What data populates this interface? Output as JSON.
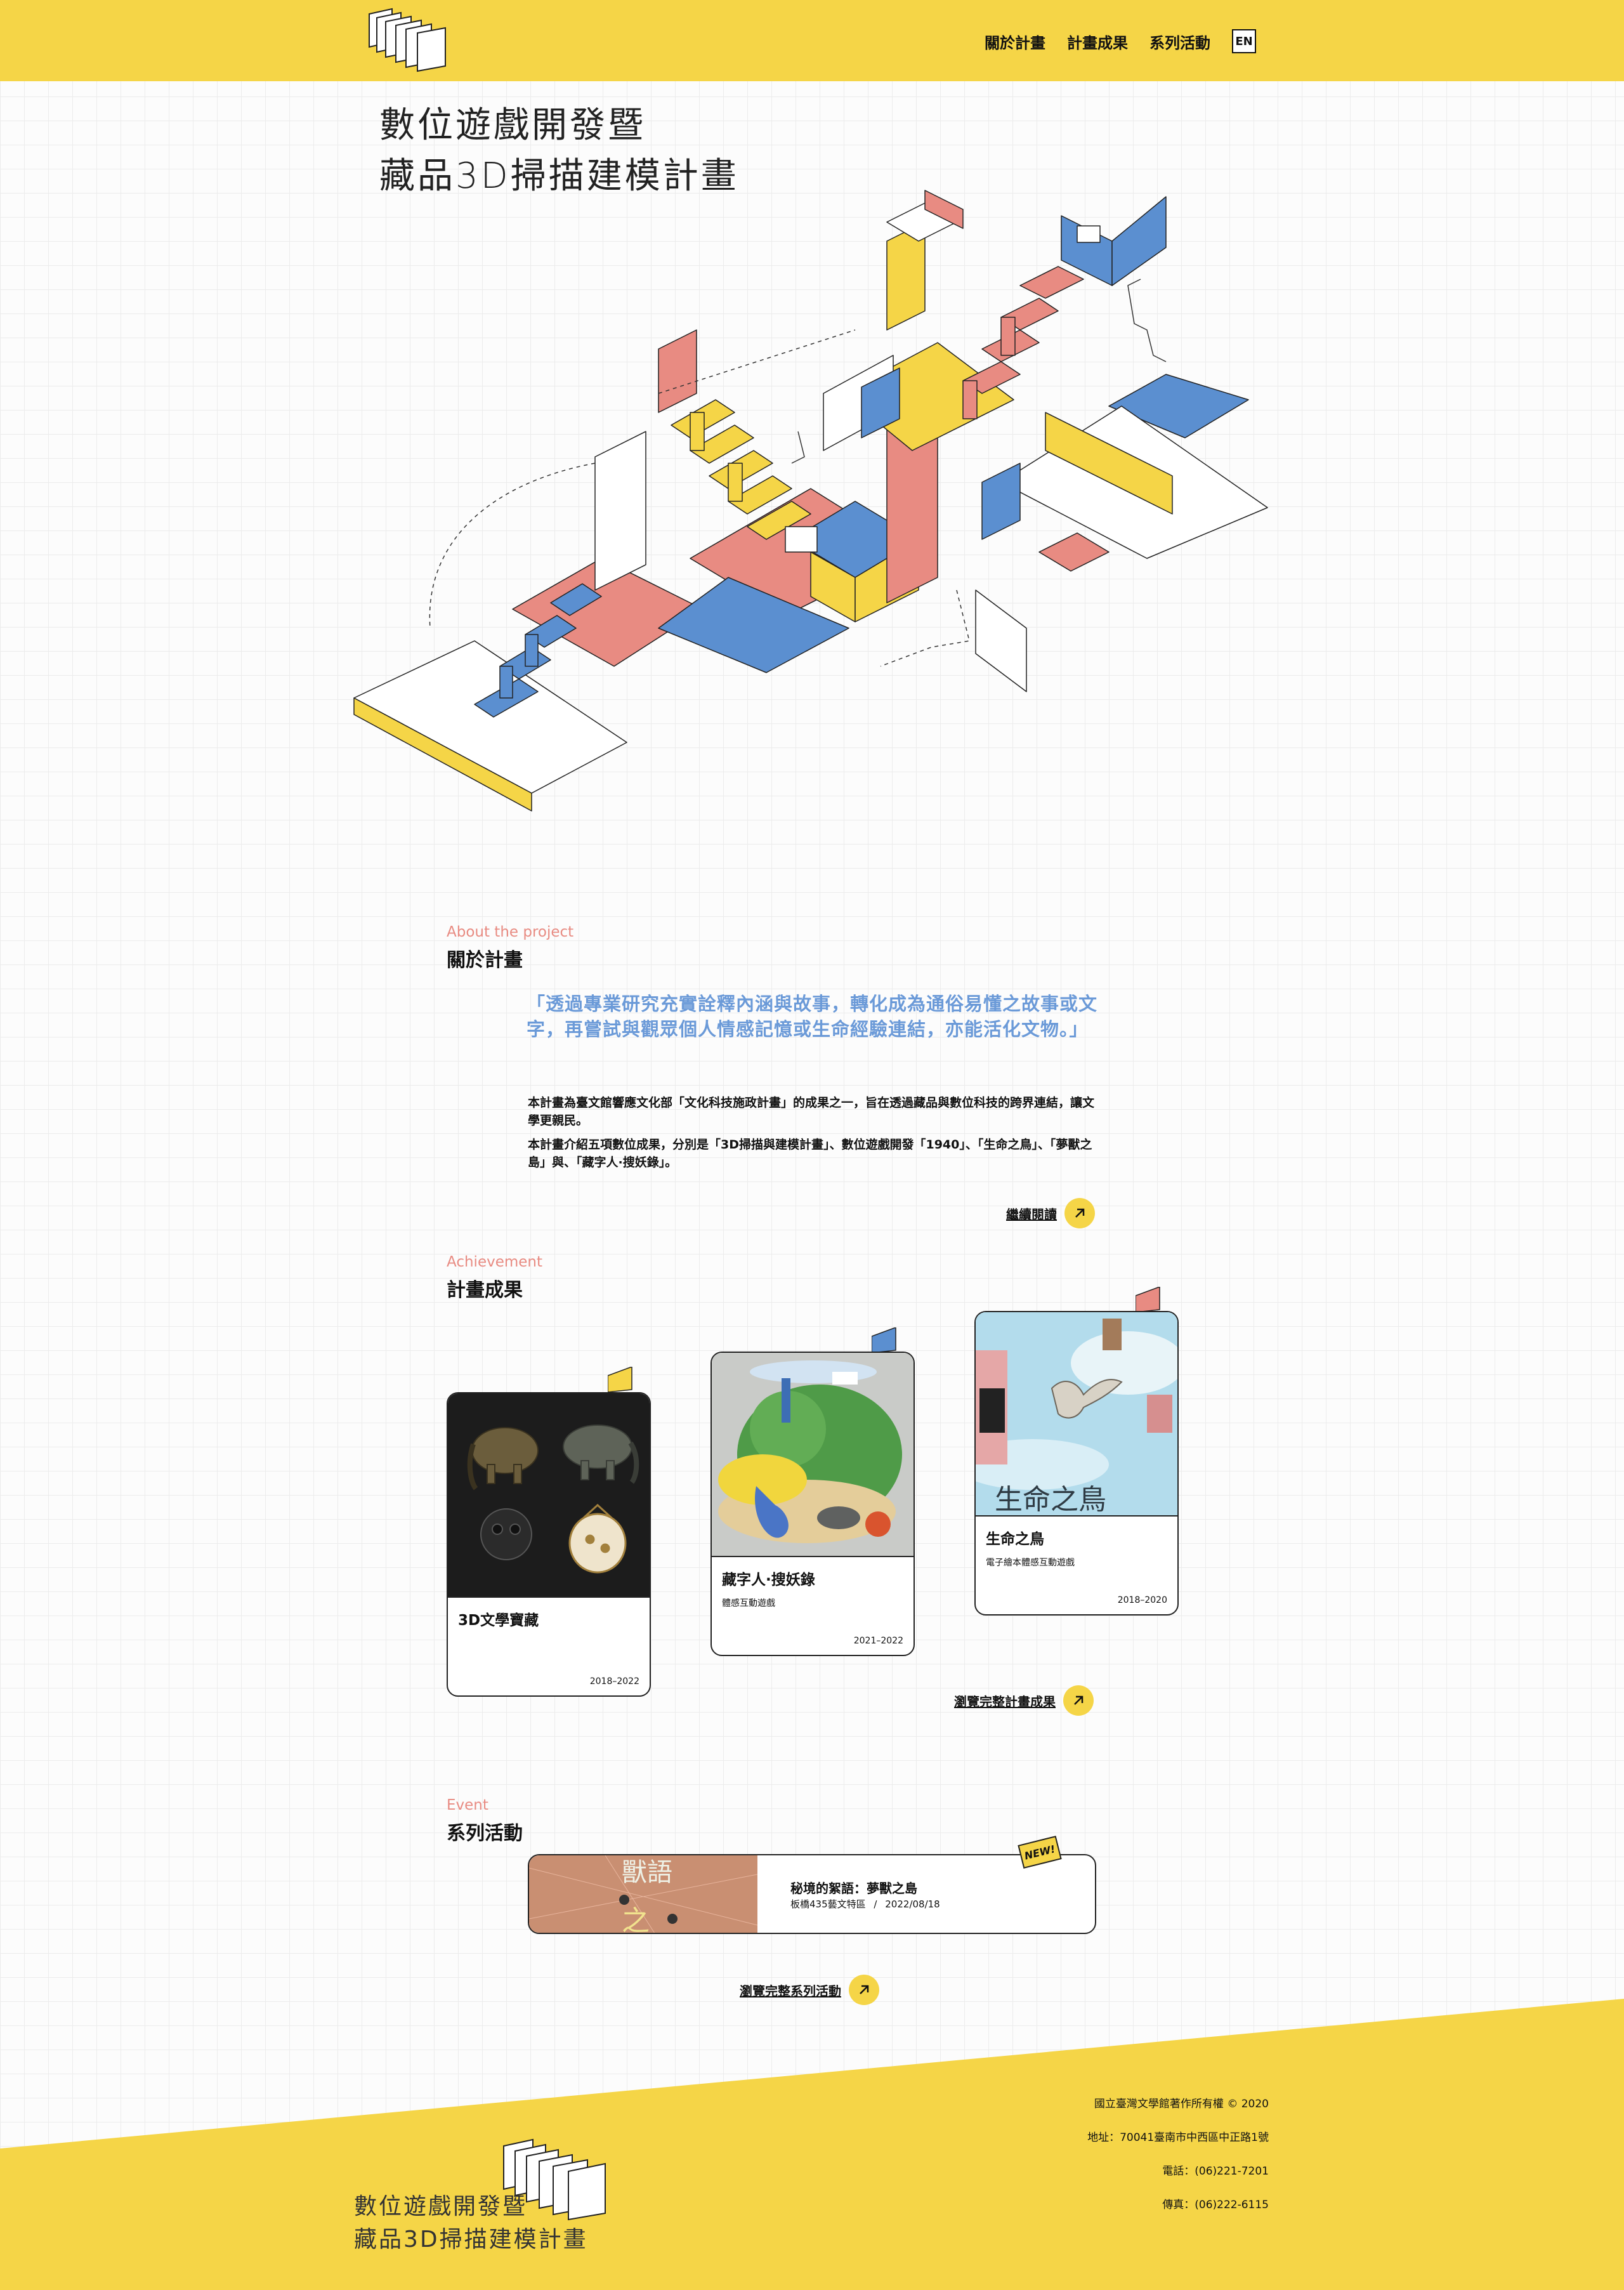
{
  "header": {
    "nav": [
      "關於計畫",
      "計畫成果",
      "系列活動"
    ],
    "lang": "EN"
  },
  "hero": {
    "title_line1": "數位遊戲開發暨",
    "title_line2": "藏品3D掃描建模計畫"
  },
  "about": {
    "label_en": "About the project",
    "label_zh": "關於計畫",
    "quote": "「透過專業研究充實詮釋內涵與故事，轉化成為通俗易懂之故事或文字，再嘗試與觀眾個人情感記憶或生命經驗連結，亦能活化文物。」",
    "p1": "本計畫為臺文館響應文化部「文化科技施政計畫」的成果之一，旨在透過藏品與數位科技的跨界連結，讓文學更親民。",
    "p2": "本計畫介紹五項數位成果，分別是「3D掃描與建模計畫」、數位遊戲開發「1940」、「生命之鳥」、「夢獸之島」與、「藏字人·搜妖錄」。",
    "more": "繼續閱讀"
  },
  "achievement": {
    "label_en": "Achievement",
    "label_zh": "計畫成果",
    "cards": [
      {
        "title": "3D文學寶藏",
        "subtitle": "",
        "years": "2018–2022",
        "flag_color": "#f5d547"
      },
      {
        "title": "藏字人·搜妖錄",
        "subtitle": "體感互動遊戲",
        "years": "2021–2022",
        "flag_color": "#5b8fd0"
      },
      {
        "title": "生命之鳥",
        "subtitle": "電子繪本體感互動遊戲",
        "years": "2018–2020",
        "flag_color": "#e88b82"
      }
    ],
    "more": "瀏覽完整計畫成果"
  },
  "event": {
    "label_en": "Event",
    "label_zh": "系列活動",
    "badge": "NEW!",
    "item": {
      "title": "秘境的絮語：夢獸之島",
      "place": "板橋435藝文特區",
      "separator": "/",
      "date": "2022/08/18",
      "thumb_text": "獸語之"
    },
    "more": "瀏覽完整系列活動"
  },
  "footer": {
    "copyright": "國立臺灣文學館著作所有權 © 2020",
    "address": "地址：70041臺南市中西區中正路1號",
    "phone": "電話：(06)221-7201",
    "fax": "傳真：(06)222-6115",
    "title_line1": "數位遊戲開發暨",
    "title_line2": "藏品3D掃描建模計畫"
  },
  "colors": {
    "yellow": "#f5d547",
    "blue": "#5b8fd0",
    "pink": "#e88b82",
    "quote_blue": "#6b9ad8"
  }
}
